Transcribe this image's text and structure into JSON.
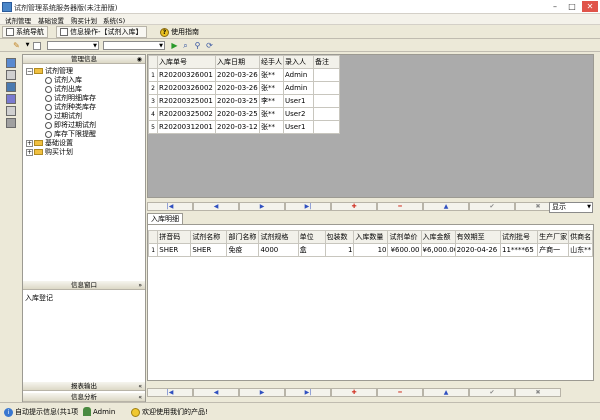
{
  "window": {
    "title": "试剂管理系统服务器版(未注册版)"
  },
  "menu": [
    "试剂管理",
    "基础设置",
    "购买计划",
    "系统(S)"
  ],
  "nav": {
    "system_nav": "系统导航",
    "info_op": "信息操作-【试剂入库】",
    "guide": "使用指南"
  },
  "left": {
    "header": "管理信息",
    "tree": [
      {
        "label": "试剂管理",
        "level": 0,
        "type": "folder",
        "expanded": true
      },
      {
        "label": "试剂入库",
        "level": 1,
        "type": "leaf"
      },
      {
        "label": "试剂出库",
        "level": 1,
        "type": "leaf"
      },
      {
        "label": "试剂明细库存",
        "level": 1,
        "type": "leaf"
      },
      {
        "label": "试剂种类库存",
        "level": 1,
        "type": "leaf"
      },
      {
        "label": "过期试剂",
        "level": 1,
        "type": "leaf"
      },
      {
        "label": "即将过期试剂",
        "level": 1,
        "type": "leaf"
      },
      {
        "label": "库存下限提醒",
        "level": 1,
        "type": "leaf"
      },
      {
        "label": "基础设置",
        "level": 0,
        "type": "folder",
        "expanded": false
      },
      {
        "label": "购买计划",
        "level": 0,
        "type": "folder",
        "expanded": false
      }
    ],
    "info_window_header": "信息窗口",
    "info_window_item": "入库登记",
    "report_header": "报表输出",
    "analysis_header": "信息分析"
  },
  "grid1": {
    "columns": [
      "入库单号",
      "入库日期",
      "经手人",
      "录入人",
      "备注"
    ],
    "rows": [
      [
        "R20200326001",
        "2020-03-26",
        "张**",
        "Admin",
        ""
      ],
      [
        "R20200326002",
        "2020-03-26",
        "张**",
        "Admin",
        ""
      ],
      [
        "R20200325001",
        "2020-03-25",
        "李**",
        "User1",
        ""
      ],
      [
        "R20200325002",
        "2020-03-25",
        "张**",
        "User2",
        ""
      ],
      [
        "R20200312001",
        "2020-03-12",
        "张**",
        "User1",
        ""
      ]
    ],
    "row_numbers": [
      "1",
      "2",
      "3",
      "4",
      "5"
    ]
  },
  "nav_buttons": [
    "|◀",
    "◀",
    "▶",
    "▶|",
    "✚",
    "━",
    "▲",
    "✔",
    "✖"
  ],
  "display_combo": "显示",
  "detail": {
    "tab": "入库明细",
    "columns": [
      "拼音码",
      "试剂名称",
      "部门名称",
      "试剂规格",
      "单位",
      "包装数",
      "入库数量",
      "试剂单价",
      "入库金额",
      "有效期至",
      "试剂批号",
      "生产厂家",
      "供商名"
    ],
    "rows": [
      [
        "SHER",
        "SHER",
        "免疫",
        "4000",
        "盒",
        "1",
        "10",
        "¥600.00",
        "¥6,000.00",
        "2020-04-26",
        "11****65",
        "产商一",
        "山东**"
      ]
    ],
    "row_numbers": [
      "1"
    ]
  },
  "status": {
    "hint": "自动提示信息(共1项",
    "user": "Admin",
    "welcome": "欢迎使用我们的产品!"
  }
}
